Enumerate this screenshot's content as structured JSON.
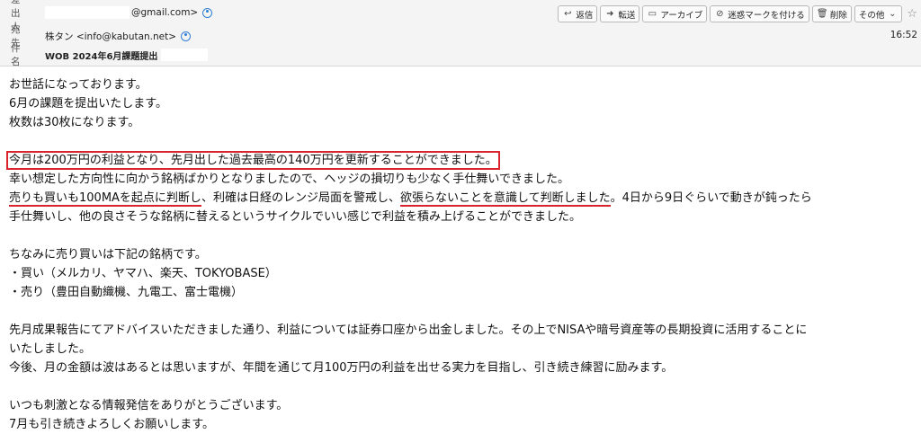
{
  "header": {
    "from_label": "差出人",
    "from_value": "@gmail.com>",
    "to_label": "宛先",
    "to_value": "株タン <info@kabutan.net>",
    "subject_label": "件名",
    "subject_value": "WOB 2024年6月課題提出",
    "time": "16:52"
  },
  "toolbar": {
    "reply": "返信",
    "forward": "転送",
    "archive": "アーカイブ",
    "junk": "迷惑マークを付ける",
    "delete": "削除",
    "more": "その他"
  },
  "body": {
    "l1": "お世話になっております。",
    "l2": "6月の課題を提出いたします。",
    "l3": "枚数は30枚になります。",
    "l4": "今月は200万円の利益となり、先月出した過去最高の140万円を更新することができました。",
    "l5": "幸い想定した方向性に向かう銘柄ばかりとなりましたので、ヘッジの損切りも少なく手仕舞いできました。",
    "l6a": "売りも買いも100MAを起点に判断し",
    "l6b": "、利確は日経のレンジ局面を警戒し、",
    "l6c": "欲張らないことを意識して判断しました",
    "l6d": "。4日から9日ぐらいで動きが鈍ったら",
    "l7": "手仕舞いし、他の良さそうな銘柄に替えるというサイクルでいい感じで利益を積み上げることができました。",
    "l8": "ちなみに売り買いは下記の銘柄です。",
    "l9": "・買い（メルカリ、ヤマハ、楽天、TOKYOBASE）",
    "l10": "・売り（豊田自動織機、九電工、富士電機）",
    "l11": "先月成果報告にてアドバイスいただきました通り、利益については証券口座から出金しました。その上でNISAや暗号資産等の長期投資に活用することに",
    "l12": "いたしました。",
    "l13": "今後、月の金額は波はあるとは思いますが、年間を通じて月100万円の利益を出せる実力を目指し、引き続き練習に励みます。",
    "l14": "いつも刺激となる情報発信をありがとうございます。",
    "l15": "7月も引き続きよろしくお願いします。"
  }
}
